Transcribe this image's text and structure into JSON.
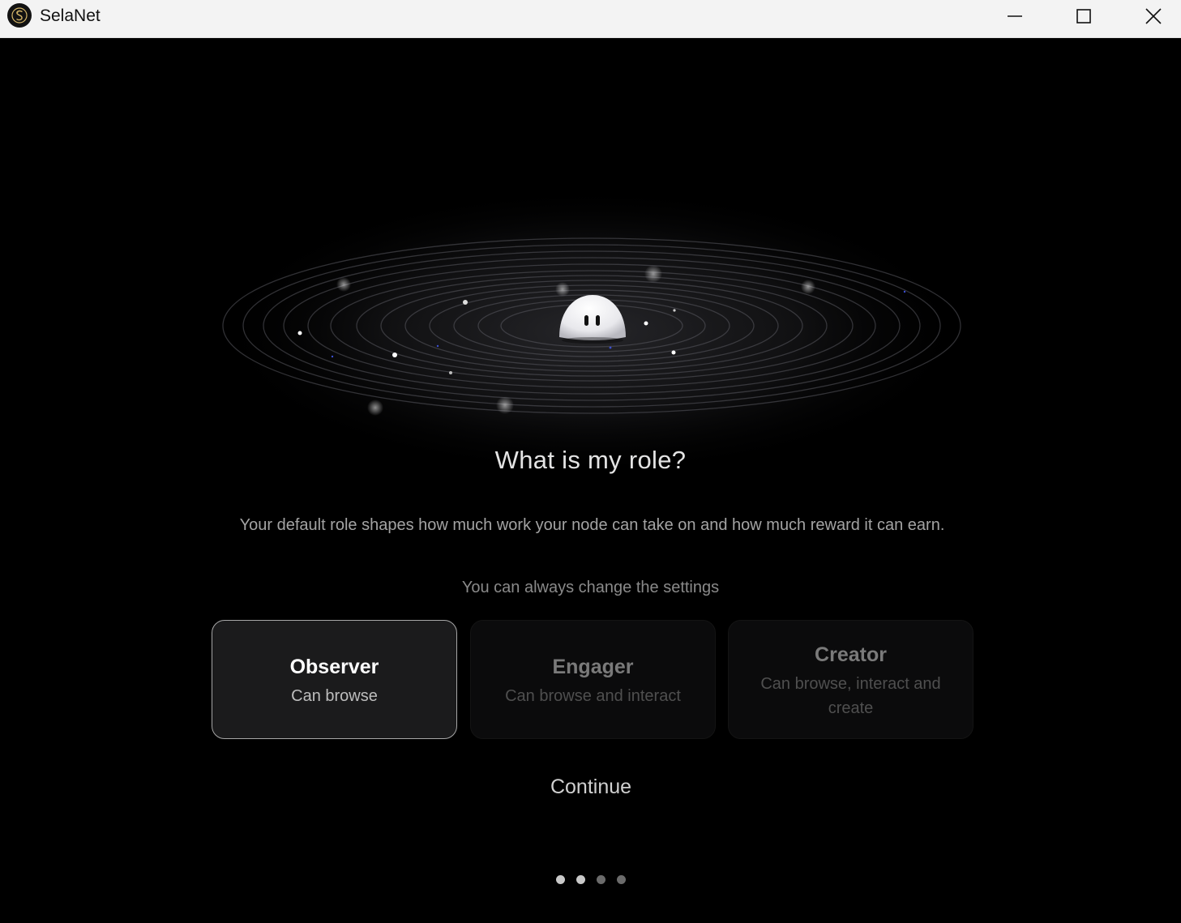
{
  "window": {
    "title": "SelaNet",
    "logo_icon": "selanet-logo-icon",
    "controls": [
      "minimize-icon",
      "maximize-icon",
      "close-icon"
    ]
  },
  "onboarding": {
    "headline": "What is my role?",
    "description": "Your default role shapes how much work your node can take on and how much reward it can earn.",
    "note": "You can always change the settings",
    "roles": [
      {
        "name": "Observer",
        "description": "Can browse",
        "selected": true
      },
      {
        "name": "Engager",
        "description": "Can browse and interact",
        "selected": false
      },
      {
        "name": "Creator",
        "description": "Can browse, interact and create",
        "selected": false
      }
    ],
    "continue_label": "Continue",
    "pager": {
      "total": 4,
      "active_index": 1
    }
  },
  "colors": {
    "background": "#000000",
    "titlebar": "#f3f3f3",
    "card_selected": "#1b1b1c",
    "card_border_selected": "#a7a7a7"
  }
}
